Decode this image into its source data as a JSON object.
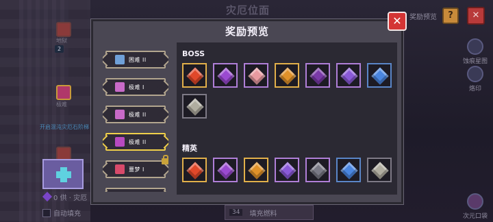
{
  "background": {
    "screen_title": "灾厄位面",
    "stage_count": "2",
    "stage_name_top": "地狱",
    "stage_name_mid": "极难",
    "stage_hint": "开启混沌灾厄石阶梯",
    "gem_counter": "0",
    "counter_suffix": "供 · 灾厄",
    "auto_fill_label": "自动填充",
    "fill_button_label": "填充燃料",
    "fill_count": "34",
    "reward_preview_label": "奖励预览",
    "help_label": "?",
    "close_label": "✕",
    "side_items": [
      {
        "label": "蚀痕星图",
        "icon": "star-map-icon"
      },
      {
        "label": "烙印",
        "icon": "brand-icon"
      },
      {
        "label": "次元口袋",
        "icon": "pocket-icon"
      }
    ]
  },
  "modal": {
    "title": "奖励预览",
    "close_label": "✕"
  },
  "difficulties": [
    {
      "label": "困难 II",
      "icon_color": "#6fa0d8",
      "selected": false,
      "locked": false
    },
    {
      "label": "极难 I",
      "icon_color": "#c86ac8",
      "selected": false,
      "locked": false
    },
    {
      "label": "极难 II",
      "icon_color": "#c86ac8",
      "selected": false,
      "locked": false
    },
    {
      "label": "极难 II",
      "icon_color": "#b84ac0",
      "selected": true,
      "locked": false
    },
    {
      "label": "噩梦 I",
      "icon_color": "#d84a6a",
      "selected": false,
      "locked": true
    }
  ],
  "sections": [
    {
      "title": "BOSS",
      "items": [
        {
          "name": "fire-crystal",
          "quality": "gold",
          "color": "#e0482a"
        },
        {
          "name": "purple-ore",
          "quality": "purple",
          "color": "#9a4ad0"
        },
        {
          "name": "pink-crystal",
          "quality": "purple",
          "color": "#e89aa0"
        },
        {
          "name": "amber-crystal",
          "quality": "gold",
          "color": "#e0922a"
        },
        {
          "name": "void-essence",
          "quality": "purple",
          "color": "#7a3aa8"
        },
        {
          "name": "amethyst",
          "quality": "purple",
          "color": "#8a5ad8"
        },
        {
          "name": "sapphire",
          "quality": "blue",
          "color": "#4a86e0"
        },
        {
          "name": "grey-stone",
          "quality": "grey",
          "color": "#b0ada0"
        }
      ]
    },
    {
      "title": "精英",
      "items": [
        {
          "name": "fire-crystal",
          "quality": "gold",
          "color": "#e0482a"
        },
        {
          "name": "purple-ore",
          "quality": "purple",
          "color": "#9a4ad0"
        },
        {
          "name": "amber-crystal",
          "quality": "gold",
          "color": "#e0922a"
        },
        {
          "name": "amethyst",
          "quality": "purple",
          "color": "#8a5ad8"
        },
        {
          "name": "dark-ore",
          "quality": "purple",
          "color": "#7a7a86"
        },
        {
          "name": "sapphire",
          "quality": "blue",
          "color": "#4a86e0"
        },
        {
          "name": "grey-stone",
          "quality": "grey",
          "color": "#b0ada0"
        }
      ]
    }
  ]
}
